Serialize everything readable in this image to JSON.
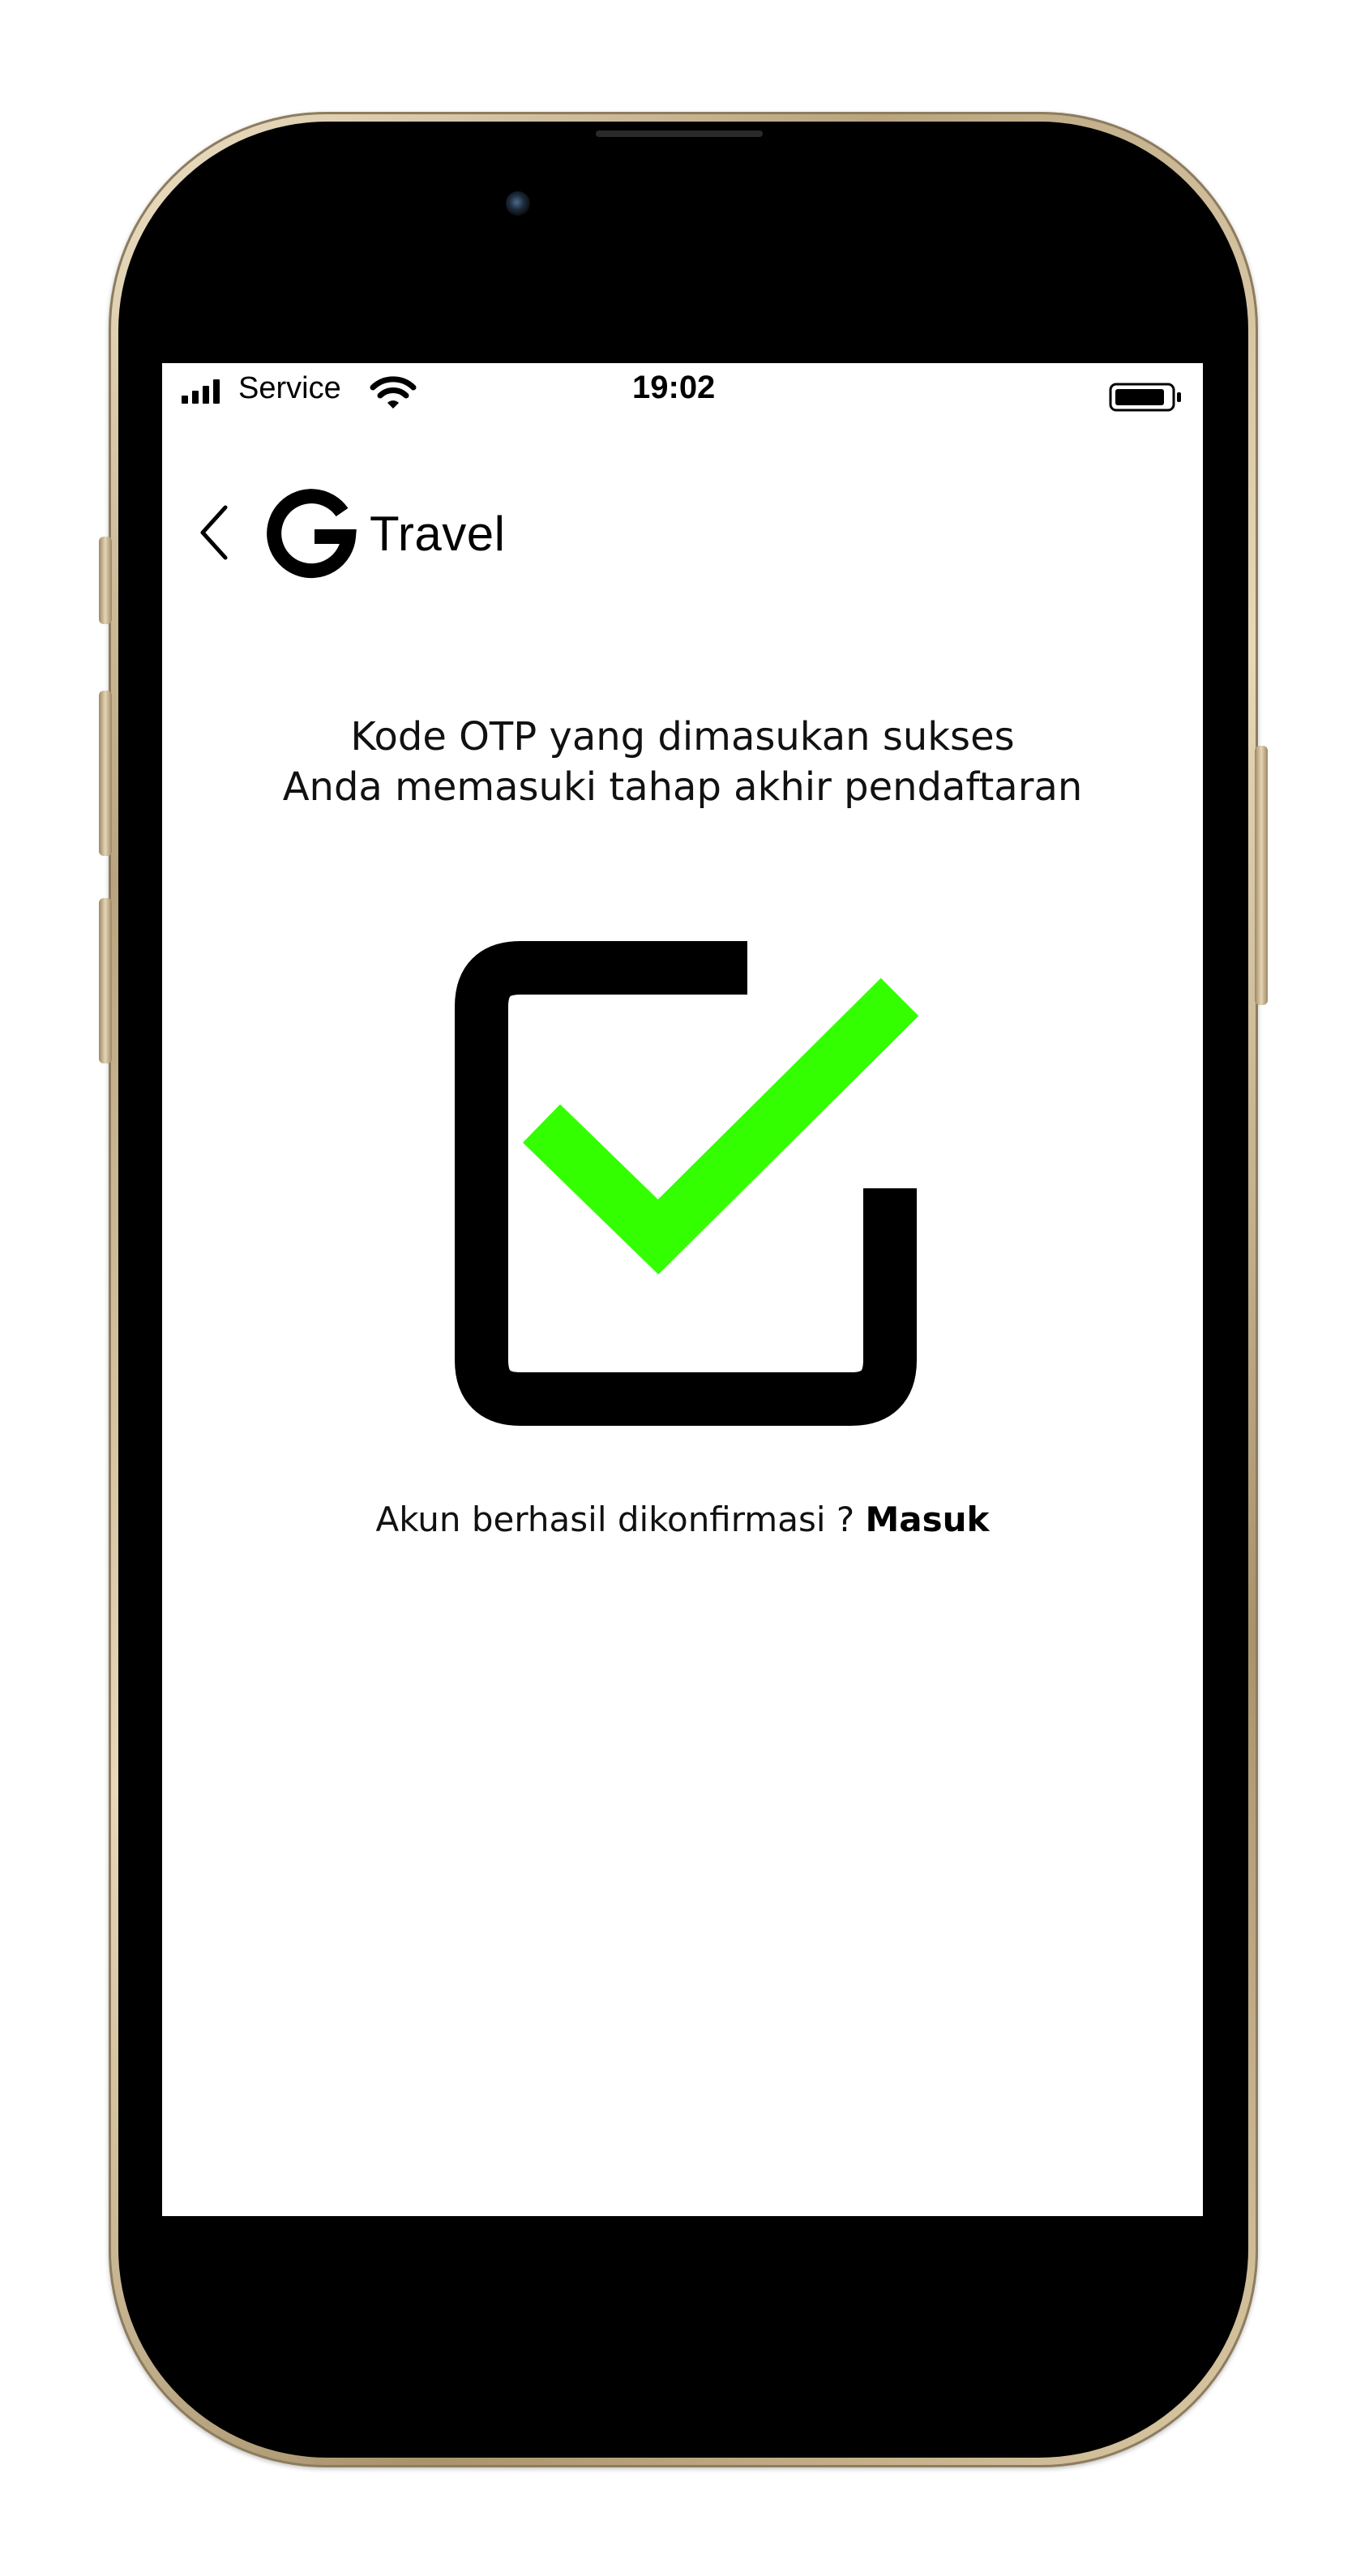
{
  "status_bar": {
    "carrier": "Service",
    "time": "19:02",
    "icons": [
      "signal-bars-icon",
      "wifi-icon",
      "battery-icon"
    ]
  },
  "header": {
    "back_icon": "chevron-left-icon",
    "logo_letter": "G",
    "brand_name": "Travel"
  },
  "message": {
    "line1": "Kode OTP yang dimasukan sukses",
    "line2": "Anda memasuki tahap akhir pendaftaran"
  },
  "illustration": {
    "icon": "checkbox-checked-icon",
    "box_color": "#000000",
    "check_color": "#33ff00"
  },
  "footer": {
    "prompt": "Akun berhasil dikonfirmasi ? ",
    "link_label": "Masuk"
  }
}
